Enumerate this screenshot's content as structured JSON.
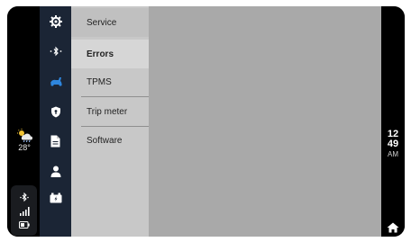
{
  "weather": {
    "temperature": "28°",
    "icon": "partly-cloudy-rain-icon"
  },
  "status": {
    "icons": [
      "bluetooth-icon",
      "signal-icon",
      "battery-icon"
    ]
  },
  "rail": {
    "icons": [
      "settings-icon",
      "bluetooth-icon",
      "scooter-icon",
      "shield-icon",
      "document-icon",
      "user-icon",
      "battery-charge-icon"
    ],
    "active_color": "#2e86de"
  },
  "menu": {
    "items": [
      {
        "label": "Service"
      },
      {
        "label": "Errors"
      },
      {
        "label": "TPMS"
      },
      {
        "label": "Trip meter"
      },
      {
        "label": "Software"
      }
    ],
    "selected": "Errors"
  },
  "clock": {
    "hours": "12",
    "minutes": "49",
    "period": "AM"
  },
  "nav": {
    "home_icon": "home-icon"
  },
  "colors": {
    "rail_bg": "#1b2535",
    "menu_bg": "#c8c8c8",
    "content_bg": "#a9a9a9"
  }
}
